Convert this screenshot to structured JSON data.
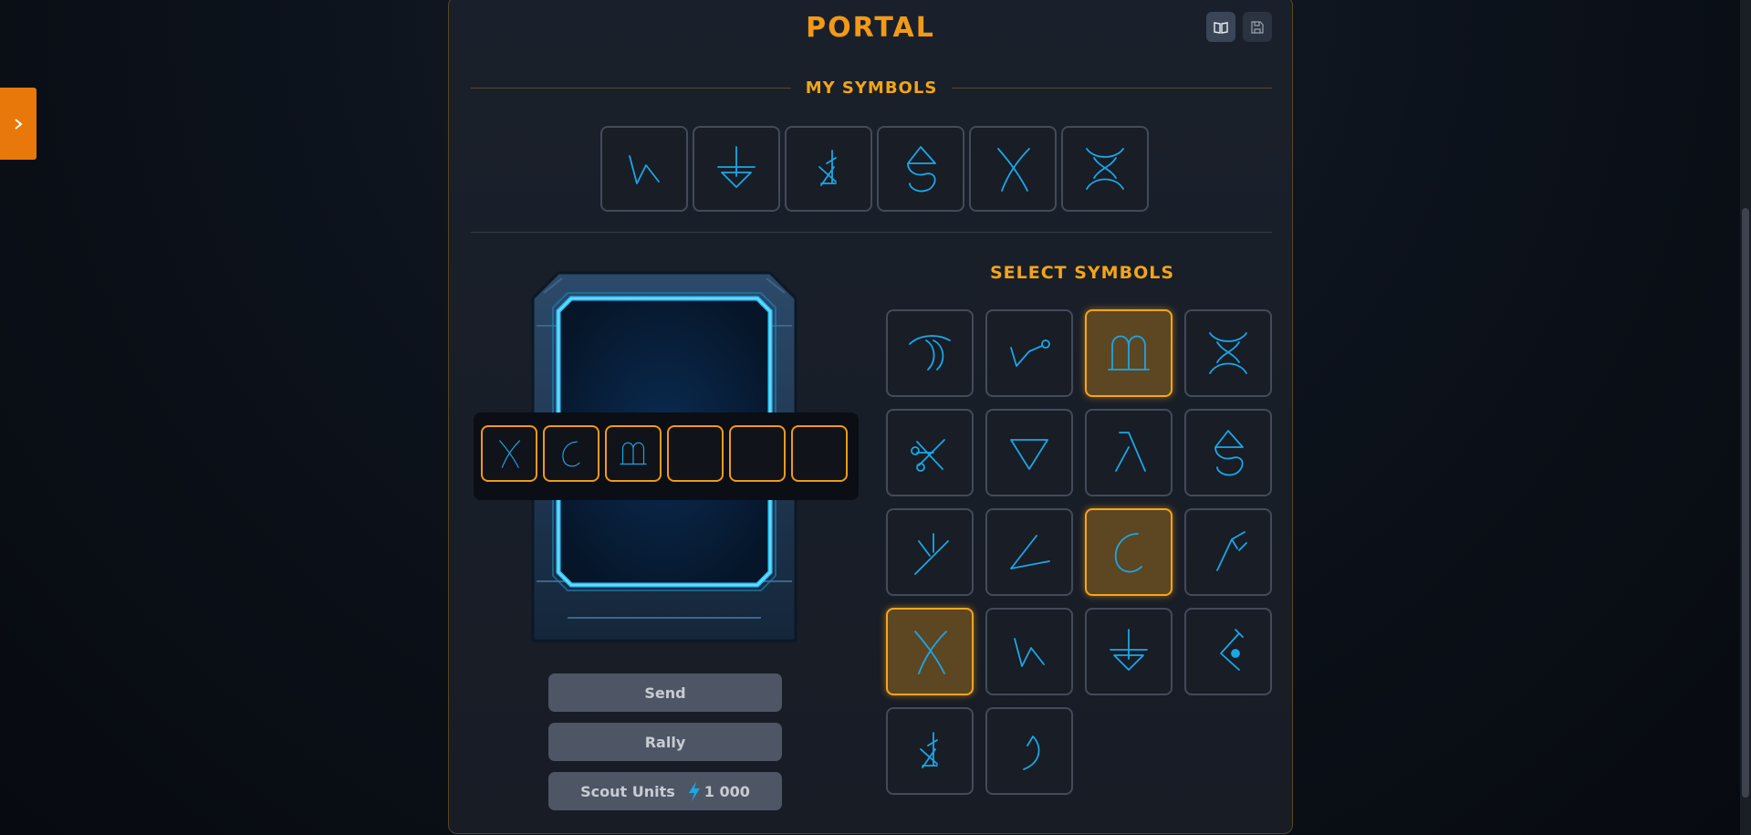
{
  "side_tab": {
    "icon": "chevron-right-icon"
  },
  "panel": {
    "title": "PORTAL",
    "buttons": [
      {
        "name": "book-icon",
        "active": true
      },
      {
        "name": "save-icon",
        "active": false
      }
    ]
  },
  "my_symbols": {
    "title": "MY SYMBOLS",
    "items": [
      "zigzag",
      "down-arrow",
      "arrow-cross",
      "drop-loop",
      "x-curve",
      "hourglass-curve"
    ]
  },
  "select_symbols": {
    "title": "SELECT SYMBOLS",
    "items": [
      {
        "glyph": "double-arc",
        "selected": false
      },
      {
        "glyph": "branch-node",
        "selected": false
      },
      {
        "glyph": "omega-m",
        "selected": true
      },
      {
        "glyph": "hourglass-curve",
        "selected": false
      },
      {
        "glyph": "cross-nodes",
        "selected": false
      },
      {
        "glyph": "triangle-down",
        "selected": false
      },
      {
        "glyph": "lambda",
        "selected": false
      },
      {
        "glyph": "drop-loop",
        "selected": false
      },
      {
        "glyph": "y-fork",
        "selected": false
      },
      {
        "glyph": "angle",
        "selected": false
      },
      {
        "glyph": "open-circle",
        "selected": true
      },
      {
        "glyph": "f-rune",
        "selected": false
      },
      {
        "glyph": "x-curve",
        "selected": true
      },
      {
        "glyph": "zigzag",
        "selected": false
      },
      {
        "glyph": "down-arrow",
        "selected": false
      },
      {
        "glyph": "arrow-dot",
        "selected": false
      },
      {
        "glyph": "arrow-cross",
        "selected": false
      },
      {
        "glyph": "hook",
        "selected": false
      }
    ]
  },
  "code_slots": [
    "x-curve",
    "open-circle",
    "omega-m",
    "",
    "",
    ""
  ],
  "actions": {
    "send": "Send",
    "rally": "Rally",
    "scout_label": "Scout Units",
    "scout_cost": "1 000"
  },
  "colors": {
    "accent": "#f29a17",
    "glyph": "#1aa7e6",
    "selected_bg": "#5d4622",
    "portal_glow": "#29c6ff"
  }
}
